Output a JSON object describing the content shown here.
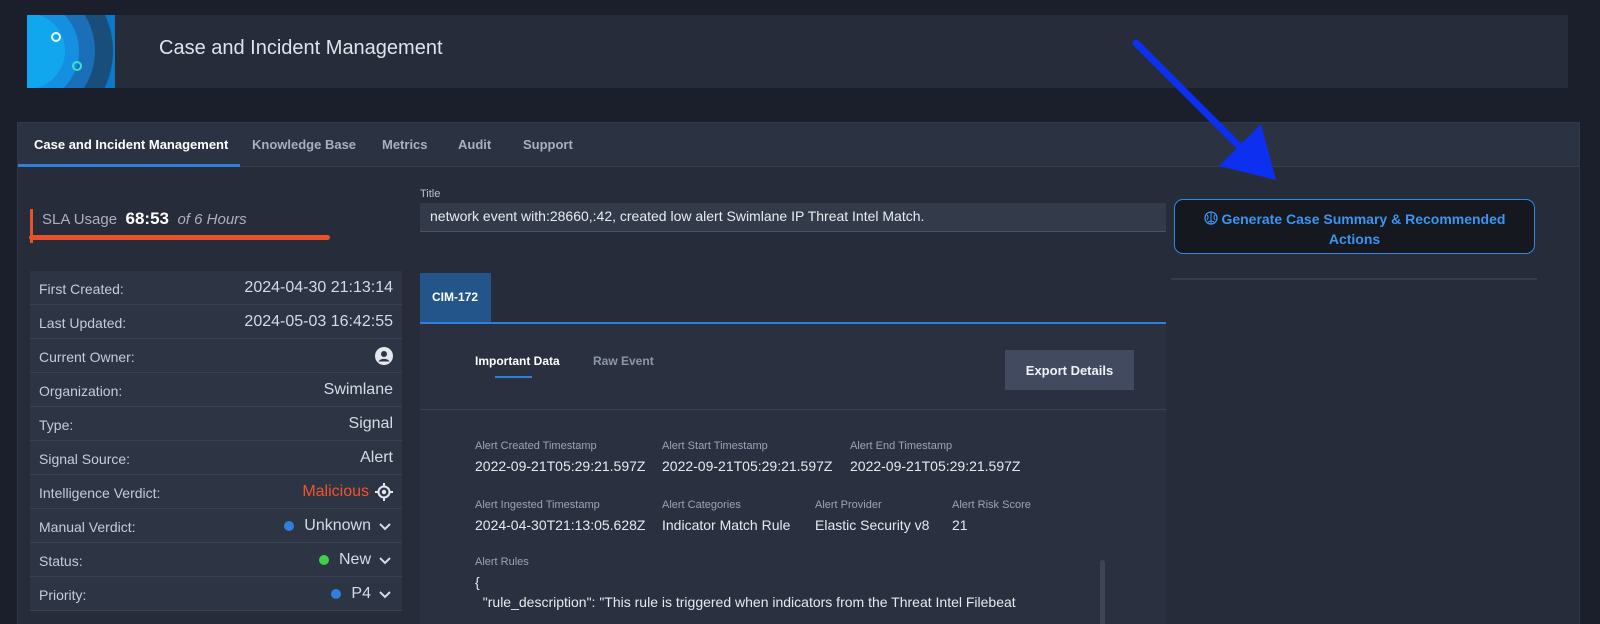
{
  "header": {
    "title": "Case and Incident Management"
  },
  "tabs": [
    {
      "label": "Case and Incident Management",
      "active": true
    },
    {
      "label": "Knowledge Base"
    },
    {
      "label": "Metrics"
    },
    {
      "label": "Audit"
    },
    {
      "label": "Support"
    }
  ],
  "sla": {
    "label": "SLA Usage",
    "value": "68:53",
    "of": "of 6 Hours"
  },
  "info": [
    {
      "label": "First Created:",
      "value": "2024-04-30 21:13:14"
    },
    {
      "label": "Last Updated:",
      "value": "2024-05-03 16:42:55"
    },
    {
      "label": "Current Owner:",
      "value": ""
    },
    {
      "label": "Organization:",
      "value": "Swimlane"
    },
    {
      "label": "Type:",
      "value": "Signal"
    },
    {
      "label": "Signal Source:",
      "value": "Alert"
    },
    {
      "label": "Intelligence Verdict:",
      "value": "Malicious"
    },
    {
      "label": "Manual Verdict:",
      "value": "Unknown"
    },
    {
      "label": "Status:",
      "value": "New"
    },
    {
      "label": "Priority:",
      "value": "P4"
    }
  ],
  "status_colors": {
    "unknown": "#2f7fdc",
    "new": "#3ed14a",
    "p4": "#2f7fdc",
    "malicious": "#f0542d"
  },
  "title": {
    "label": "Title",
    "value": "network event with:28660,:42, created low alert Swimlane IP Threat Intel Match."
  },
  "case_tab": "CIM-172",
  "subtabs": {
    "important": "Important Data",
    "raw": "Raw Event"
  },
  "export_label": "Export Details",
  "fields": [
    {
      "label": "Alert Created Timestamp",
      "value": "2022-09-21T05:29:21.597Z"
    },
    {
      "label": "Alert Start Timestamp",
      "value": "2022-09-21T05:29:21.597Z"
    },
    {
      "label": "Alert End Timestamp",
      "value": "2022-09-21T05:29:21.597Z"
    },
    {
      "label": "Alert Ingested Timestamp",
      "value": "2024-04-30T21:13:05.628Z"
    },
    {
      "label": "Alert Categories",
      "value": "Indicator Match Rule"
    },
    {
      "label": "Alert Provider",
      "value": "Elastic Security v8"
    },
    {
      "label": "Alert Risk Score",
      "value": "21"
    }
  ],
  "alert_rules": {
    "label": "Alert Rules",
    "line1": "{",
    "line2": "  \"rule_description\": \"This rule is triggered when indicators from the Threat Intel Filebeat"
  },
  "generate_button": "Generate Case Summary & Recommended Actions"
}
